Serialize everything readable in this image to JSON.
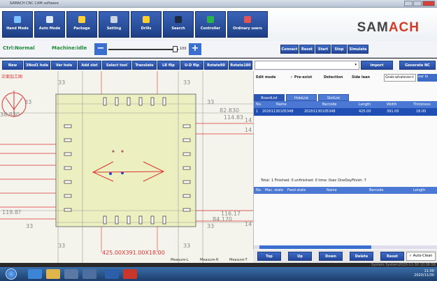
{
  "window": {
    "title": "SAMACH CNC CAM software"
  },
  "toolbar": {
    "buttons": [
      {
        "label": "Hand Mode",
        "icon": "hand-icon"
      },
      {
        "label": "Auto Mode",
        "icon": "auto-icon"
      },
      {
        "label": "Package",
        "icon": "package-icon"
      },
      {
        "label": "Setting",
        "icon": "setting-icon"
      },
      {
        "label": "Drills",
        "icon": "drill-icon"
      },
      {
        "label": "Search",
        "icon": "search-icon"
      },
      {
        "label": "Controller",
        "icon": "controller-icon"
      },
      {
        "label": "Ordinary users",
        "icon": "user-icon"
      }
    ],
    "logo_prefix": "SAM",
    "logo_suffix": "ACH"
  },
  "status": {
    "ctrl": "Ctrl:Normal",
    "machine": "Machine:idle",
    "minus": "−",
    "plus": "+",
    "speed_value": "100",
    "actions": [
      "Connect",
      "Reset",
      "Start",
      "Stop",
      "Simulate"
    ]
  },
  "tools": {
    "buttons": [
      "New",
      "3Nod1 hole",
      "Ver hole",
      "Add slot",
      "Select tool",
      "Translate",
      "LR flip",
      "U-D flip",
      "Rotate90",
      "Rotate180"
    ],
    "import": "Import",
    "generate": "Generate NC",
    "dropdown": "▾"
  },
  "canvas": {
    "left_title": "正面加工图",
    "label_33a": "33",
    "label_33b": "33",
    "label_33c": "33",
    "label_33d": "33",
    "label_33e": "33",
    "label_33f": "33",
    "label_33g": "33",
    "label_33h": "33",
    "label_14a": "14",
    "label_14b": "14",
    "label_14c": "14",
    "dim_82": "82.830",
    "dim_114": "114.83",
    "dim_116": "116.17",
    "dim_84": "84.170",
    "dim_38": "38.830",
    "dim_119": "119.8?",
    "dimension": "425.00X391.00X18.00"
  },
  "measure": [
    "Measure-L",
    "Measure-R",
    "Measure-T"
  ],
  "right": {
    "edit_mode": "Edit mode",
    "preexist": "✓ Pre-exist",
    "detection": "Detection",
    "side_lean": "Side lean",
    "grab": "Grab-whatever-t",
    "edit_btn": "ear lo",
    "tabs": [
      "BoardList",
      "HoleList",
      "SlotList"
    ],
    "grid_headers": [
      "No.",
      "Name",
      "Barcode",
      "Length",
      "Width",
      "Thickness"
    ],
    "rows": [
      [
        "1",
        "20201130105348",
        "20201130105348",
        "425.00",
        "391.00",
        "18.00"
      ]
    ],
    "totals": "Total: 1  Finished: 0  unfinished: 0 time: 0sec OneDayFinish: 7",
    "grid2_headers": [
      "No.",
      "Mac. state",
      "Feed state",
      "Name",
      "Barcode",
      "Length"
    ],
    "bottom": [
      "Top",
      "Up",
      "Down",
      "Delete",
      "Reset"
    ],
    "autoclean": "✓ Auto-Clean",
    "sys": "System  System2020-11-30 10:36:58"
  },
  "taskbar": {
    "time": "11:00",
    "date": "2020/11/30"
  }
}
